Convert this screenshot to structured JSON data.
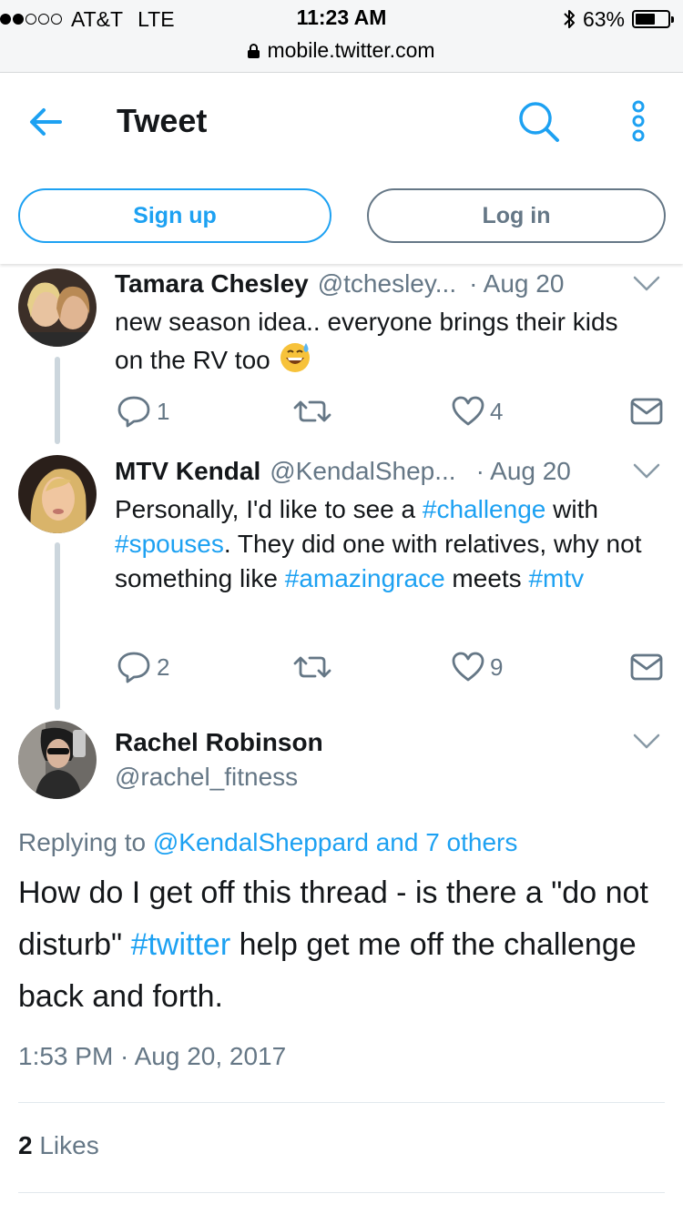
{
  "status_bar": {
    "carrier": "AT&T",
    "network": "LTE",
    "signal_bars_filled": 2,
    "signal_bars_total": 5,
    "time": "11:23 AM",
    "battery_percent": "63%",
    "battery_level": 0.63,
    "url": "mobile.twitter.com"
  },
  "header": {
    "title": "Tweet",
    "signup_label": "Sign up",
    "login_label": "Log in"
  },
  "tweets": [
    {
      "name": "Tamara Chesley",
      "handle": "@tchesley...",
      "date": "· Aug 20",
      "text_1": "new season idea.. everyone brings their kids on the RV too",
      "emoji": "grinning-sweat-emoji",
      "replies": "1",
      "likes": "4"
    },
    {
      "name": "MTV Kendal",
      "handle": "@KendalShep...",
      "date": "· Aug 20",
      "text_1": "Personally, I'd like to see a ",
      "tag_1": "#challenge",
      "text_2": " with ",
      "tag_2": "#spouses",
      "text_3": ". They did one with relatives, why not something like ",
      "tag_3": "#amazingrace",
      "text_4": " meets ",
      "tag_4": "#mtv",
      "replies": "2",
      "likes": "9"
    }
  ],
  "focused_tweet": {
    "name": "Rachel Robinson",
    "handle": "@rachel_fitness",
    "replying_prefix": "Replying to ",
    "replying_targets": "@KendalSheppard and 7 others",
    "text_1": "How do I get off this thread - is there a \"do not disturb\" ",
    "tag_1": "#twitter",
    "text_2": " help get me off the challenge back and forth.",
    "timestamp": "1:53 PM · Aug 20, 2017",
    "likes_count": "2",
    "likes_label": "Likes"
  },
  "colors": {
    "accent": "#1da1f2",
    "secondary_text": "#657786",
    "thread_line": "#ccd6dd"
  }
}
